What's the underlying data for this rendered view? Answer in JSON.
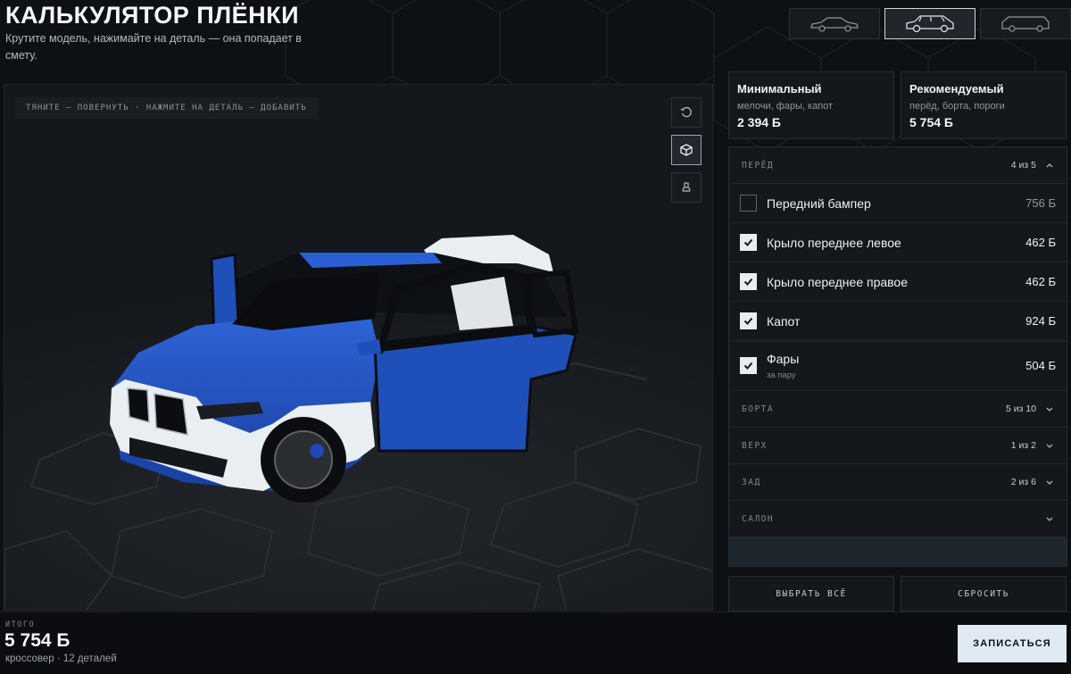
{
  "header": {
    "title": "КАЛЬКУЛЯТОР ПЛЁНКИ",
    "subtitle": "Крутите модель, нажимайте на деталь — она попадает в смету."
  },
  "body_types": [
    {
      "icon": "sedan-icon",
      "active": false
    },
    {
      "icon": "crossover-icon",
      "active": true
    },
    {
      "icon": "minivan-icon",
      "active": false
    }
  ],
  "viewer": {
    "hint": "ТЯНИТЕ — ПОВЕРНУТЬ · НАЖМИТЕ НА ДЕТАЛЬ — ДОБАВИТЬ",
    "tools": [
      {
        "icon": "reset-view-icon"
      },
      {
        "icon": "cube-view-icon",
        "active": true
      },
      {
        "icon": "lamp-icon"
      }
    ],
    "colors": {
      "body": "#1f4fb8",
      "film": "#e9eef3",
      "floor": "#1c1f23"
    }
  },
  "presets": [
    {
      "name": "Минимальный",
      "desc": "мелочи, фары, капот",
      "price": "2 394 Ƃ"
    },
    {
      "name": "Рекомендуемый",
      "desc": "перёд, борта, пороги",
      "price": "5 754 Ƃ"
    }
  ],
  "sections": {
    "front": {
      "title": "ПЕРЁД",
      "count": "4 из 5",
      "expanded": true,
      "items": [
        {
          "name": "Передний бампер",
          "sub": "",
          "price": "756 Ƃ",
          "checked": false
        },
        {
          "name": "Крыло переднее левое",
          "sub": "",
          "price": "462 Ƃ",
          "checked": true
        },
        {
          "name": "Крыло переднее правое",
          "sub": "",
          "price": "462 Ƃ",
          "checked": true
        },
        {
          "name": "Капот",
          "sub": "",
          "price": "924 Ƃ",
          "checked": true
        },
        {
          "name": "Фары",
          "sub": "за пару",
          "price": "504 Ƃ",
          "checked": true
        }
      ]
    },
    "collapsed": [
      {
        "title": "БОРТА",
        "count": "5 из 10"
      },
      {
        "title": "ВЕРХ",
        "count": "1 из 2"
      },
      {
        "title": "ЗАД",
        "count": "2 из 6"
      },
      {
        "title": "САЛОН",
        "count": ""
      }
    ]
  },
  "actions": {
    "select_all": "ВЫБРАТЬ ВСЁ",
    "reset": "СБРОСИТЬ"
  },
  "footer": {
    "label": "ИТОГО",
    "total": "5 754 Ƃ",
    "sub": "кроссовер · 12 деталей",
    "cta": "ЗАПИСАТЬСЯ"
  }
}
